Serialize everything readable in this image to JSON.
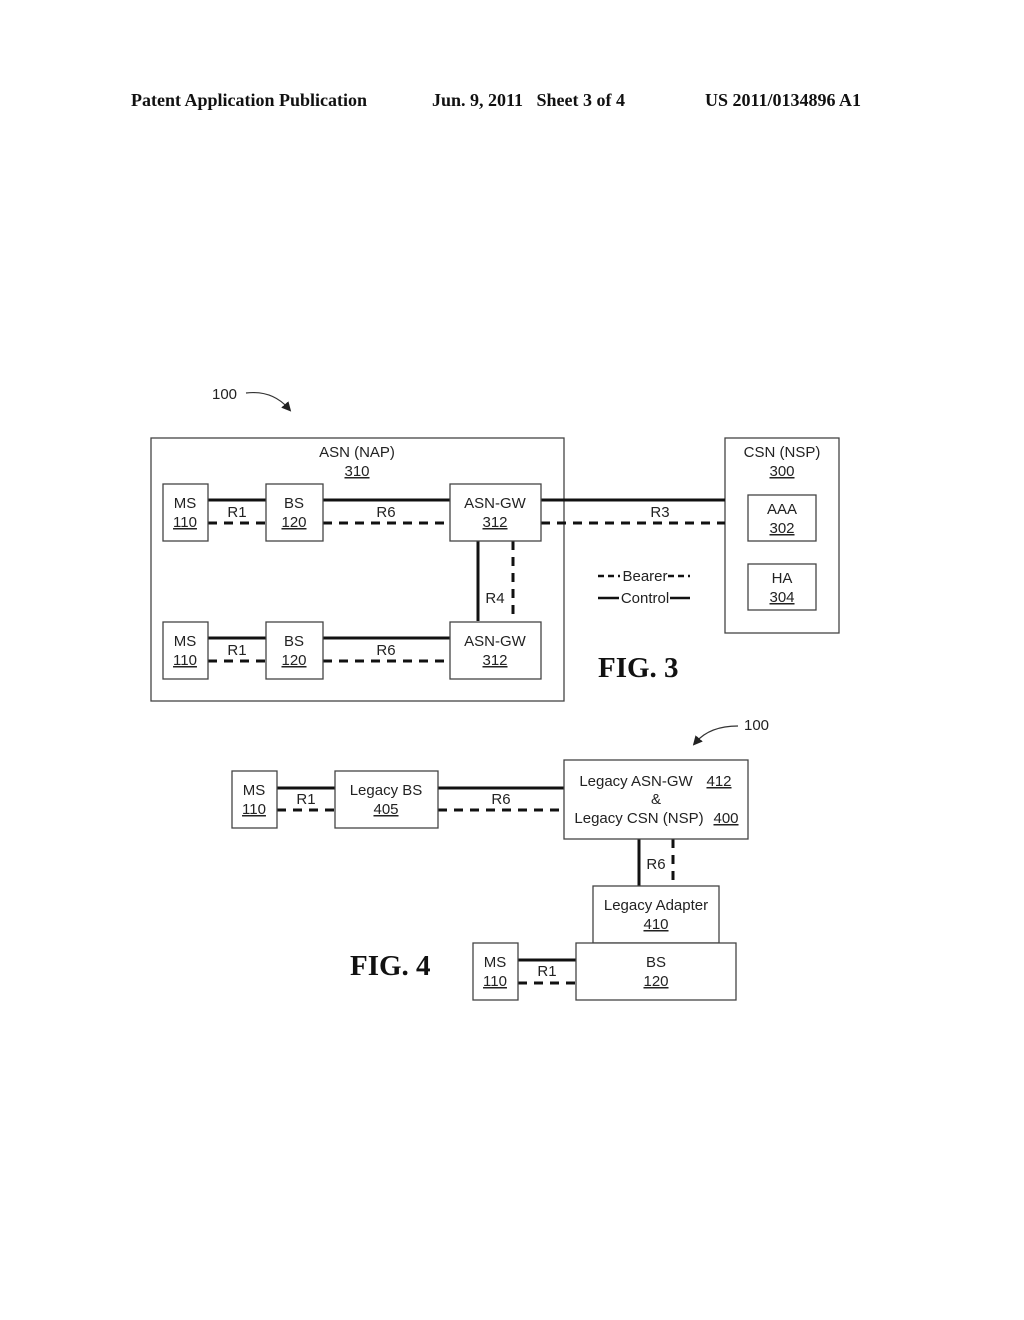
{
  "header": {
    "publication": "Patent Application Publication",
    "date_sheet": "Jun. 9, 2011   Sheet 3 of 4",
    "number": "US 2011/0134896 A1"
  },
  "fig3": {
    "caption": "FIG. 3",
    "ref": "100",
    "asn": {
      "title": "ASN (NAP)",
      "num": "310"
    },
    "csn": {
      "title": "CSN (NSP)",
      "num": "300"
    },
    "aaa": {
      "title": "AAA",
      "num": "302"
    },
    "ha": {
      "title": "HA",
      "num": "304"
    },
    "ms_top": {
      "title": "MS",
      "num": "110"
    },
    "bs_top": {
      "title": "BS",
      "num": "120"
    },
    "gw_top": {
      "title": "ASN-GW",
      "num": "312"
    },
    "ms_bot": {
      "title": "MS",
      "num": "110"
    },
    "bs_bot": {
      "title": "BS",
      "num": "120"
    },
    "gw_bot": {
      "title": "ASN-GW",
      "num": "312"
    },
    "links": {
      "r1": "R1",
      "r6": "R6",
      "r3": "R3",
      "r4": "R4"
    },
    "legend": {
      "bearer": "Bearer",
      "control": "Control"
    }
  },
  "fig4": {
    "caption": "FIG. 4",
    "ref": "100",
    "ms_top": {
      "title": "MS",
      "num": "110"
    },
    "legacy_bs": {
      "title": "Legacy BS",
      "num": "405"
    },
    "legacy_gw": {
      "line1": "Legacy ASN-GW",
      "num1": "412",
      "amp": "&",
      "line2": "Legacy CSN (NSP)",
      "num2": "400"
    },
    "adapter": {
      "title": "Legacy Adapter",
      "num": "410"
    },
    "bs": {
      "title": "BS",
      "num": "120"
    },
    "ms_bot": {
      "title": "MS",
      "num": "110"
    },
    "links": {
      "r1": "R1",
      "r6": "R6",
      "r6_vert": "R6",
      "r1_bot": "R1"
    }
  }
}
